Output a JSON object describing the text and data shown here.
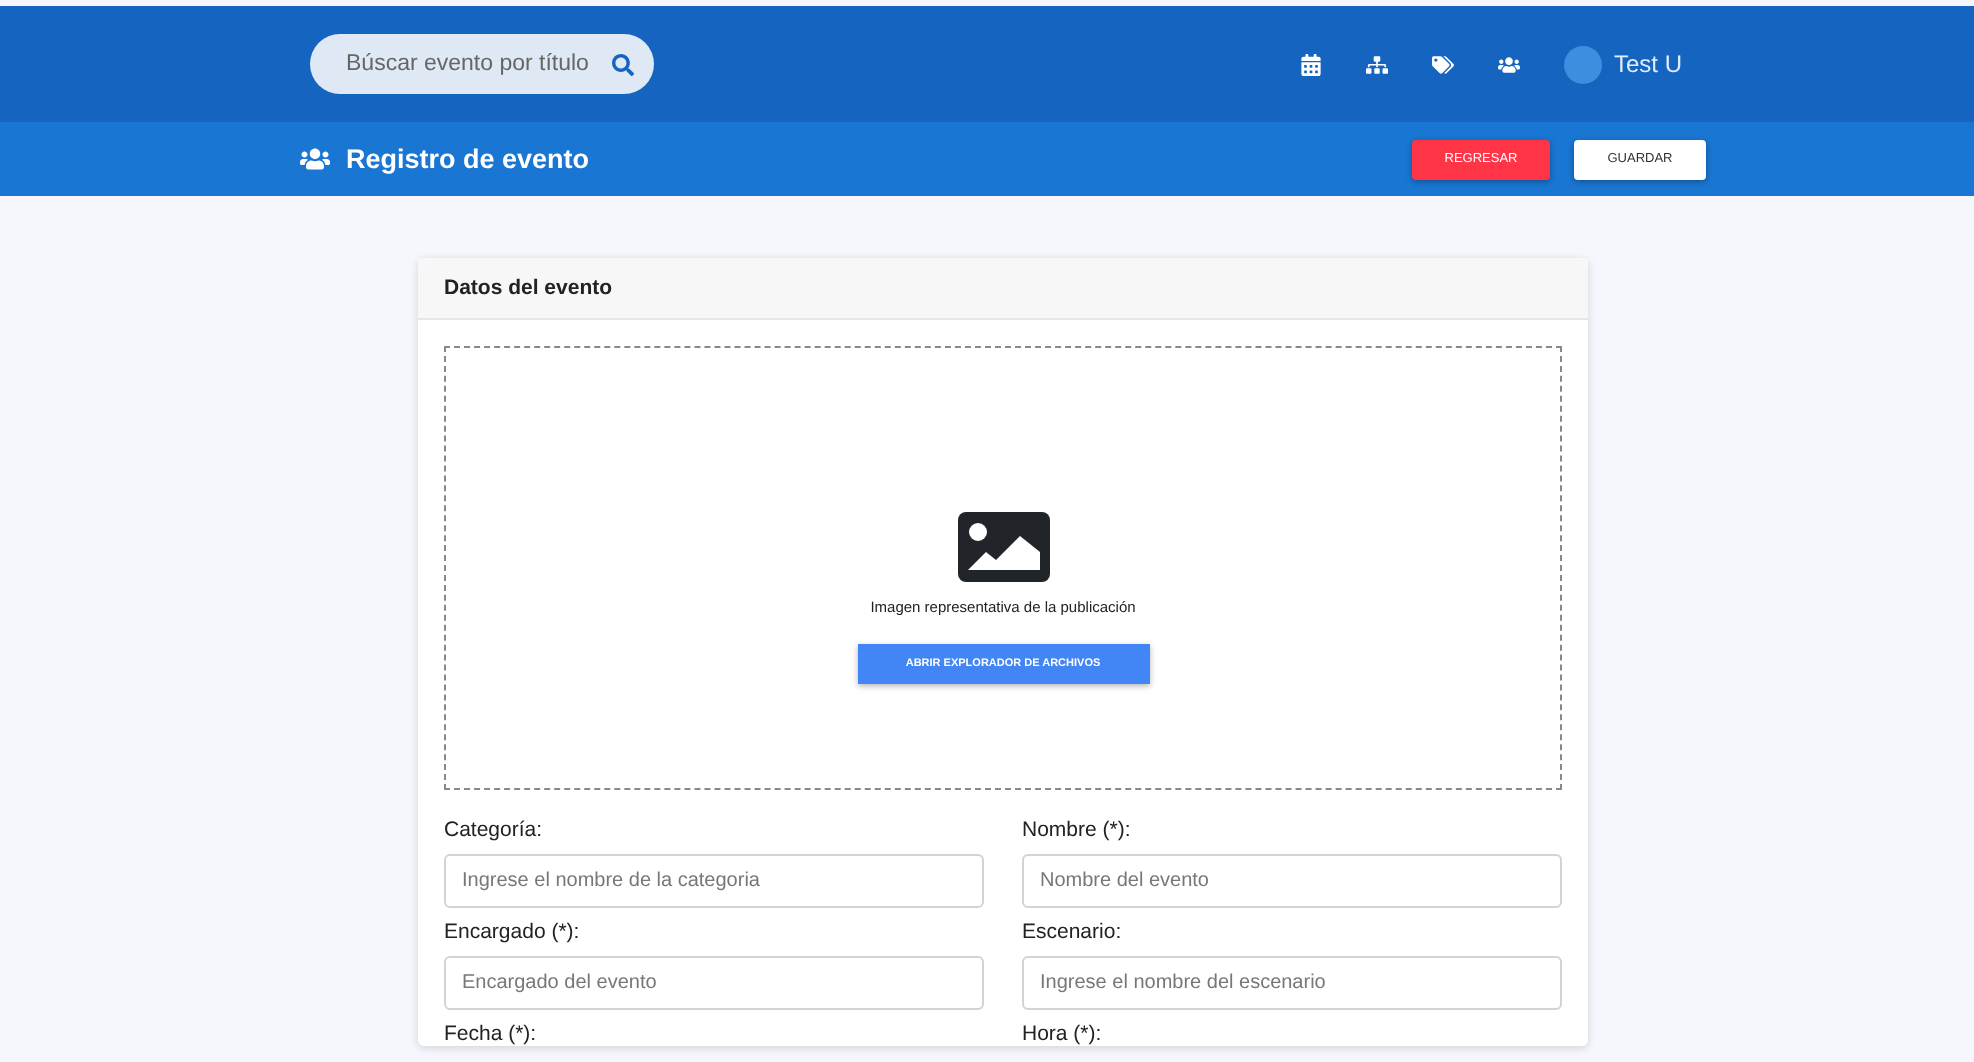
{
  "search": {
    "placeholder": "Búscar evento por título"
  },
  "nav": {
    "icons": [
      {
        "kind": "calendar"
      },
      {
        "kind": "sitemap"
      },
      {
        "kind": "tags"
      },
      {
        "kind": "users"
      }
    ],
    "user": "Test U"
  },
  "toolbar": {
    "title": "Registro de evento",
    "buttons": [
      {
        "label": "REGRESAR",
        "kind": "danger"
      },
      {
        "label": "GUARDAR",
        "kind": "light"
      }
    ]
  },
  "card": {
    "title": "Datos del evento",
    "upload": {
      "caption": "Imagen representativa de la publicación",
      "button": "ABRIR EXPLORADOR DE ARCHIVOS"
    },
    "fields": [
      {
        "label": "Categoría:",
        "placeholder": "Ingrese el nombre de la categoria"
      },
      {
        "label": "Nombre (*):",
        "placeholder": "Nombre del evento"
      },
      {
        "label": "Encargado (*):",
        "placeholder": "Encargado del evento"
      },
      {
        "label": "Escenario:",
        "placeholder": "Ingrese el nombre del escenario"
      },
      {
        "label": "Fecha (*):"
      },
      {
        "label": "Hora (*):"
      }
    ]
  }
}
